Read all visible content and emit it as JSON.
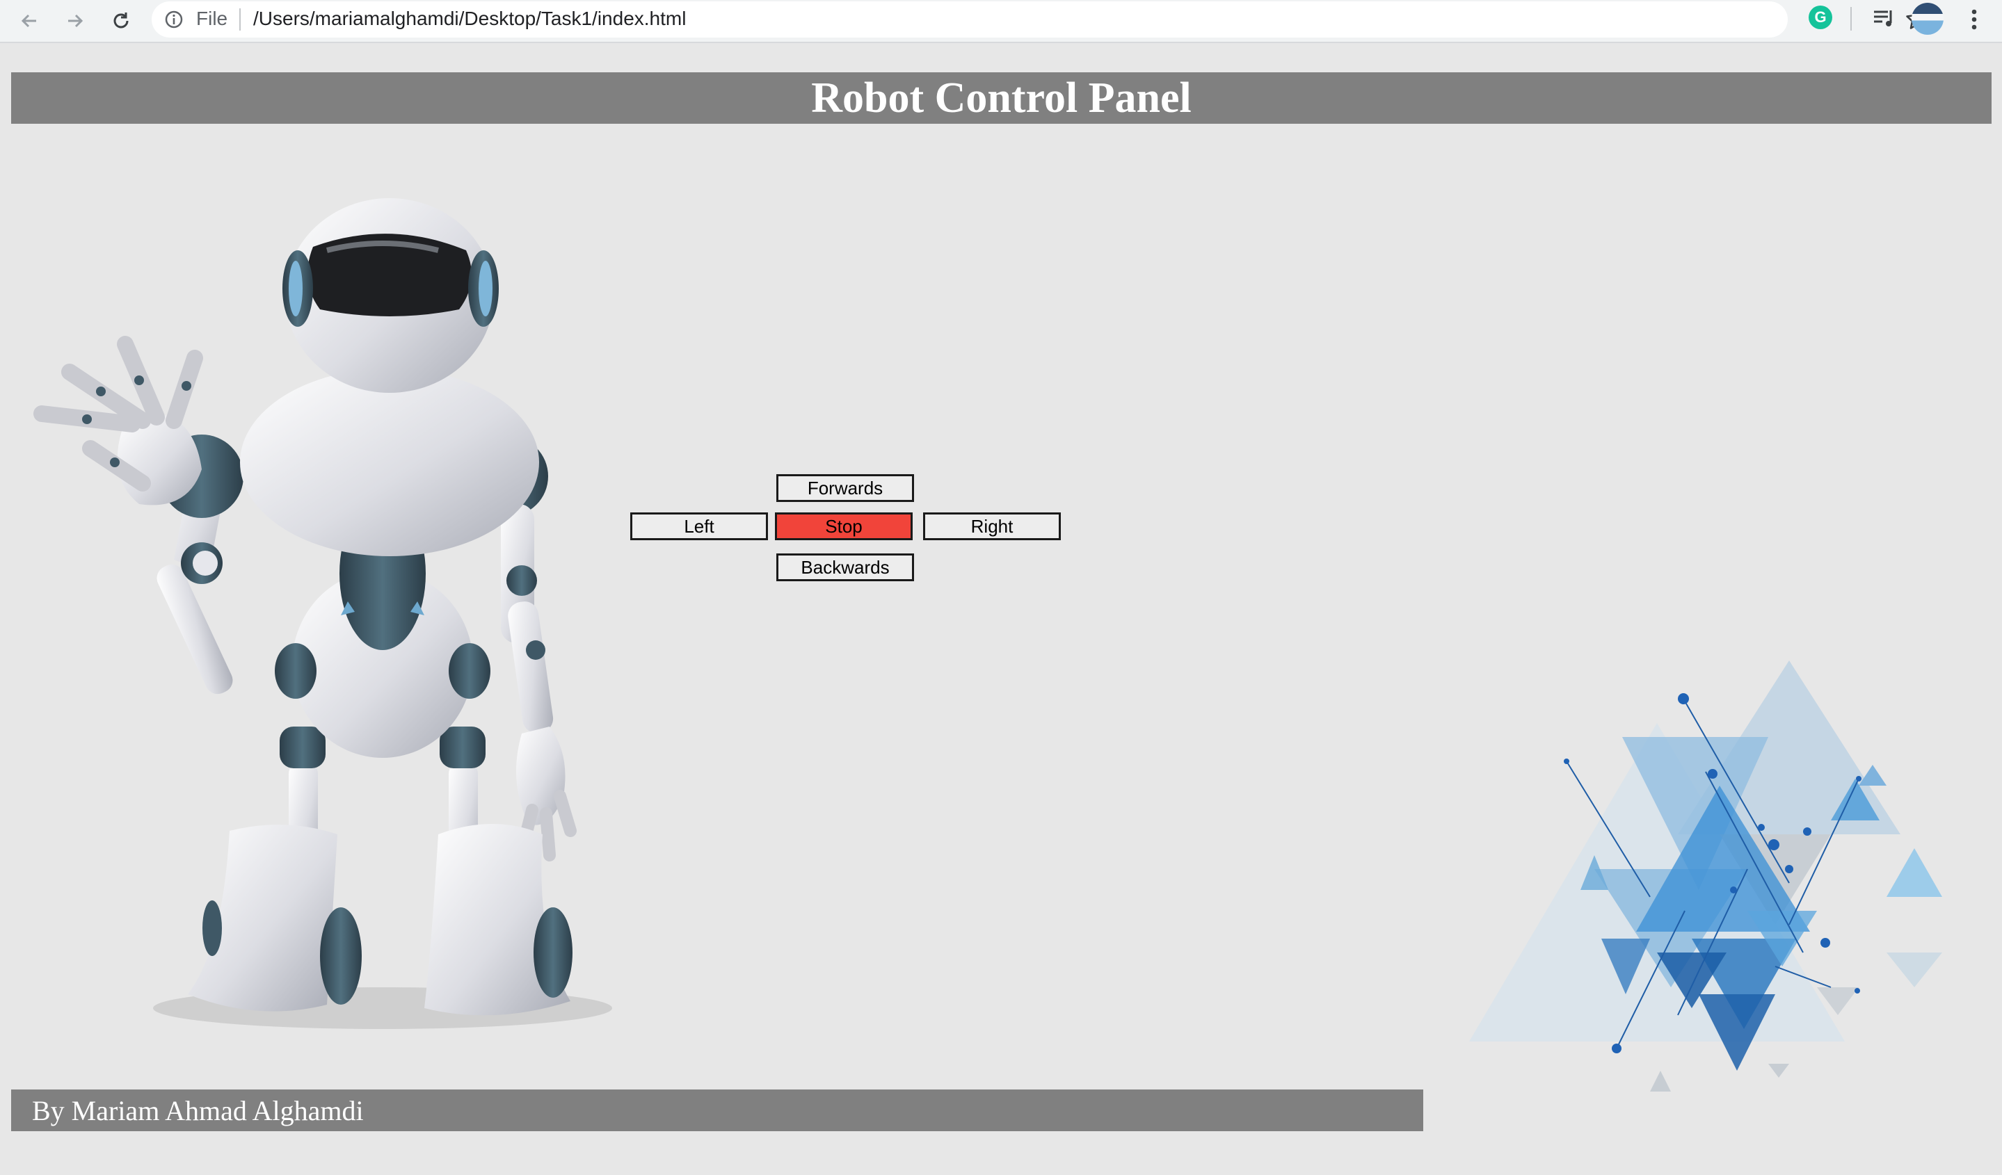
{
  "browser": {
    "scheme_label": "File",
    "url": "/Users/mariamalghamdi/Desktop/Task1/index.html",
    "extension_letter": "G",
    "icons": [
      "back-arrow-icon",
      "forward-arrow-icon",
      "reload-icon",
      "info-icon",
      "star-icon",
      "grammarly-icon",
      "media-control-icon",
      "profile-avatar",
      "menu-dots-icon"
    ]
  },
  "page": {
    "title": "Robot Control Panel",
    "footer": "By Mariam Ahmad Alghamdi"
  },
  "controls": {
    "forwards": "Forwards",
    "left": "Left",
    "stop": "Stop",
    "right": "Right",
    "backwards": "Backwards"
  },
  "colors": {
    "page_background": "#e7e7e7",
    "bar_gray": "#808080",
    "stop_red": "#f1443a",
    "robot_white": "#dcdde3",
    "robot_joint": "#3f5866",
    "deco_blue": "#3a8fd6"
  }
}
